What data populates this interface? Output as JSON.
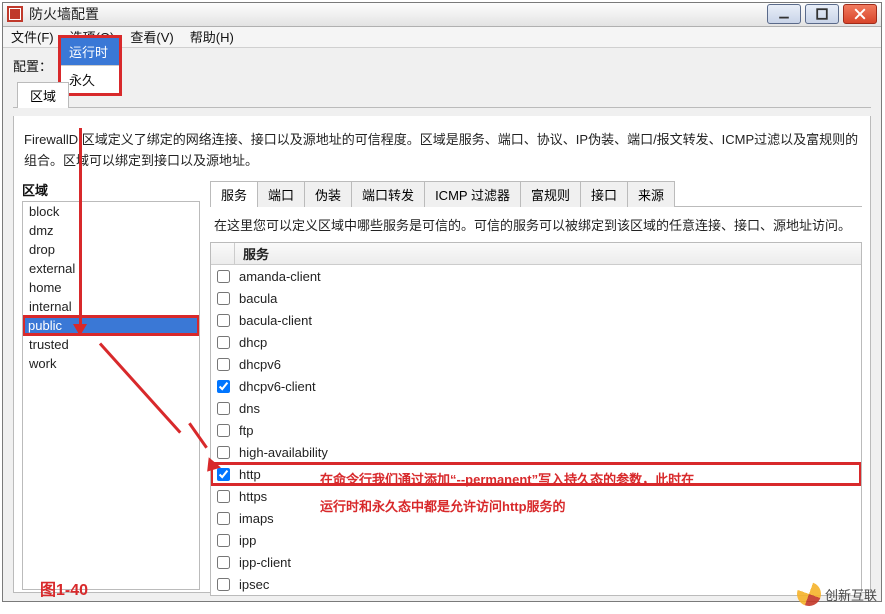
{
  "window": {
    "title": "防火墙配置"
  },
  "menu": {
    "file": "文件(F)",
    "options": "选项(O)",
    "view": "查看(V)",
    "help": "帮助(H)"
  },
  "config": {
    "label": "配置：",
    "selected": "运行时",
    "alt": "永久"
  },
  "outer_tab": "区域",
  "description": "FirewallD 区域定义了绑定的网络连接、接口以及源地址的可信程度。区域是服务、端口、协议、IP伪装、端口/报文转发、ICMP过滤以及富规则的组合。区域可以绑定到接口以及源地址。",
  "zones": {
    "header": "区域",
    "items": [
      "block",
      "dmz",
      "drop",
      "external",
      "home",
      "internal",
      "public",
      "trusted",
      "work"
    ],
    "selected": "public"
  },
  "svc_tabs": [
    "服务",
    "端口",
    "伪装",
    "端口转发",
    "ICMP 过滤器",
    "富规则",
    "接口",
    "来源"
  ],
  "svc_tab_active": "服务",
  "svc_desc": "在这里您可以定义区域中哪些服务是可信的。可信的服务可以被绑定到该区域的任意连接、接口、源地址访问。",
  "svc_header": "服务",
  "services": [
    {
      "name": "amanda-client",
      "checked": false
    },
    {
      "name": "bacula",
      "checked": false
    },
    {
      "name": "bacula-client",
      "checked": false
    },
    {
      "name": "dhcp",
      "checked": false
    },
    {
      "name": "dhcpv6",
      "checked": false
    },
    {
      "name": "dhcpv6-client",
      "checked": true
    },
    {
      "name": "dns",
      "checked": false
    },
    {
      "name": "ftp",
      "checked": false
    },
    {
      "name": "high-availability",
      "checked": false
    },
    {
      "name": "http",
      "checked": true,
      "highlight": true
    },
    {
      "name": "https",
      "checked": false
    },
    {
      "name": "imaps",
      "checked": false
    },
    {
      "name": "ipp",
      "checked": false
    },
    {
      "name": "ipp-client",
      "checked": false
    },
    {
      "name": "ipsec",
      "checked": false
    }
  ],
  "annotation": {
    "line1": "在命令行我们通过添加“--permanent”写入持久态的参数，此时在",
    "line2": "运行时和永久态中都是允许访问http服务的"
  },
  "figure_label": "图1-40",
  "watermark": "创新互联"
}
